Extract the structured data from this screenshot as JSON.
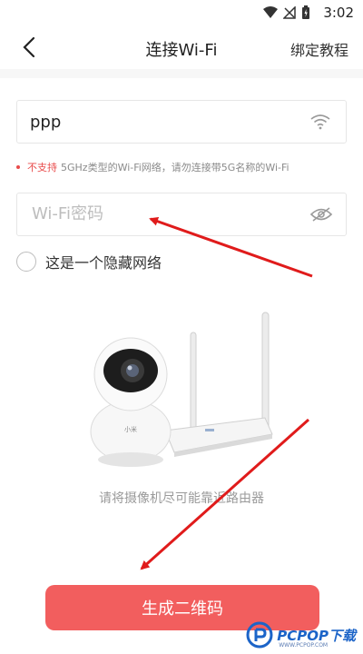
{
  "status_bar": {
    "time": "3:02"
  },
  "nav": {
    "title": "连接Wi-Fi",
    "right_link": "绑定教程"
  },
  "ssid": {
    "value": "ppp"
  },
  "tip": {
    "warn": "不支持",
    "rest": "5GHz类型的Wi-Fi网络，请勿连接带5G名称的Wi-Fi"
  },
  "password": {
    "placeholder": "Wi-Fi密码"
  },
  "hidden_network": {
    "label": "这是一个隐藏网络"
  },
  "camera": {
    "brand": "小米"
  },
  "hint": "请将摄像机尽可能靠近路由器",
  "qr_button": {
    "label": "生成二维码"
  },
  "watermark": {
    "text": "PCPOP下载",
    "sub": "WWW.PCPOP.COM"
  },
  "colors": {
    "accent": "#f25e5e",
    "warn": "#e94b4b",
    "arrow": "#e01b1b"
  }
}
